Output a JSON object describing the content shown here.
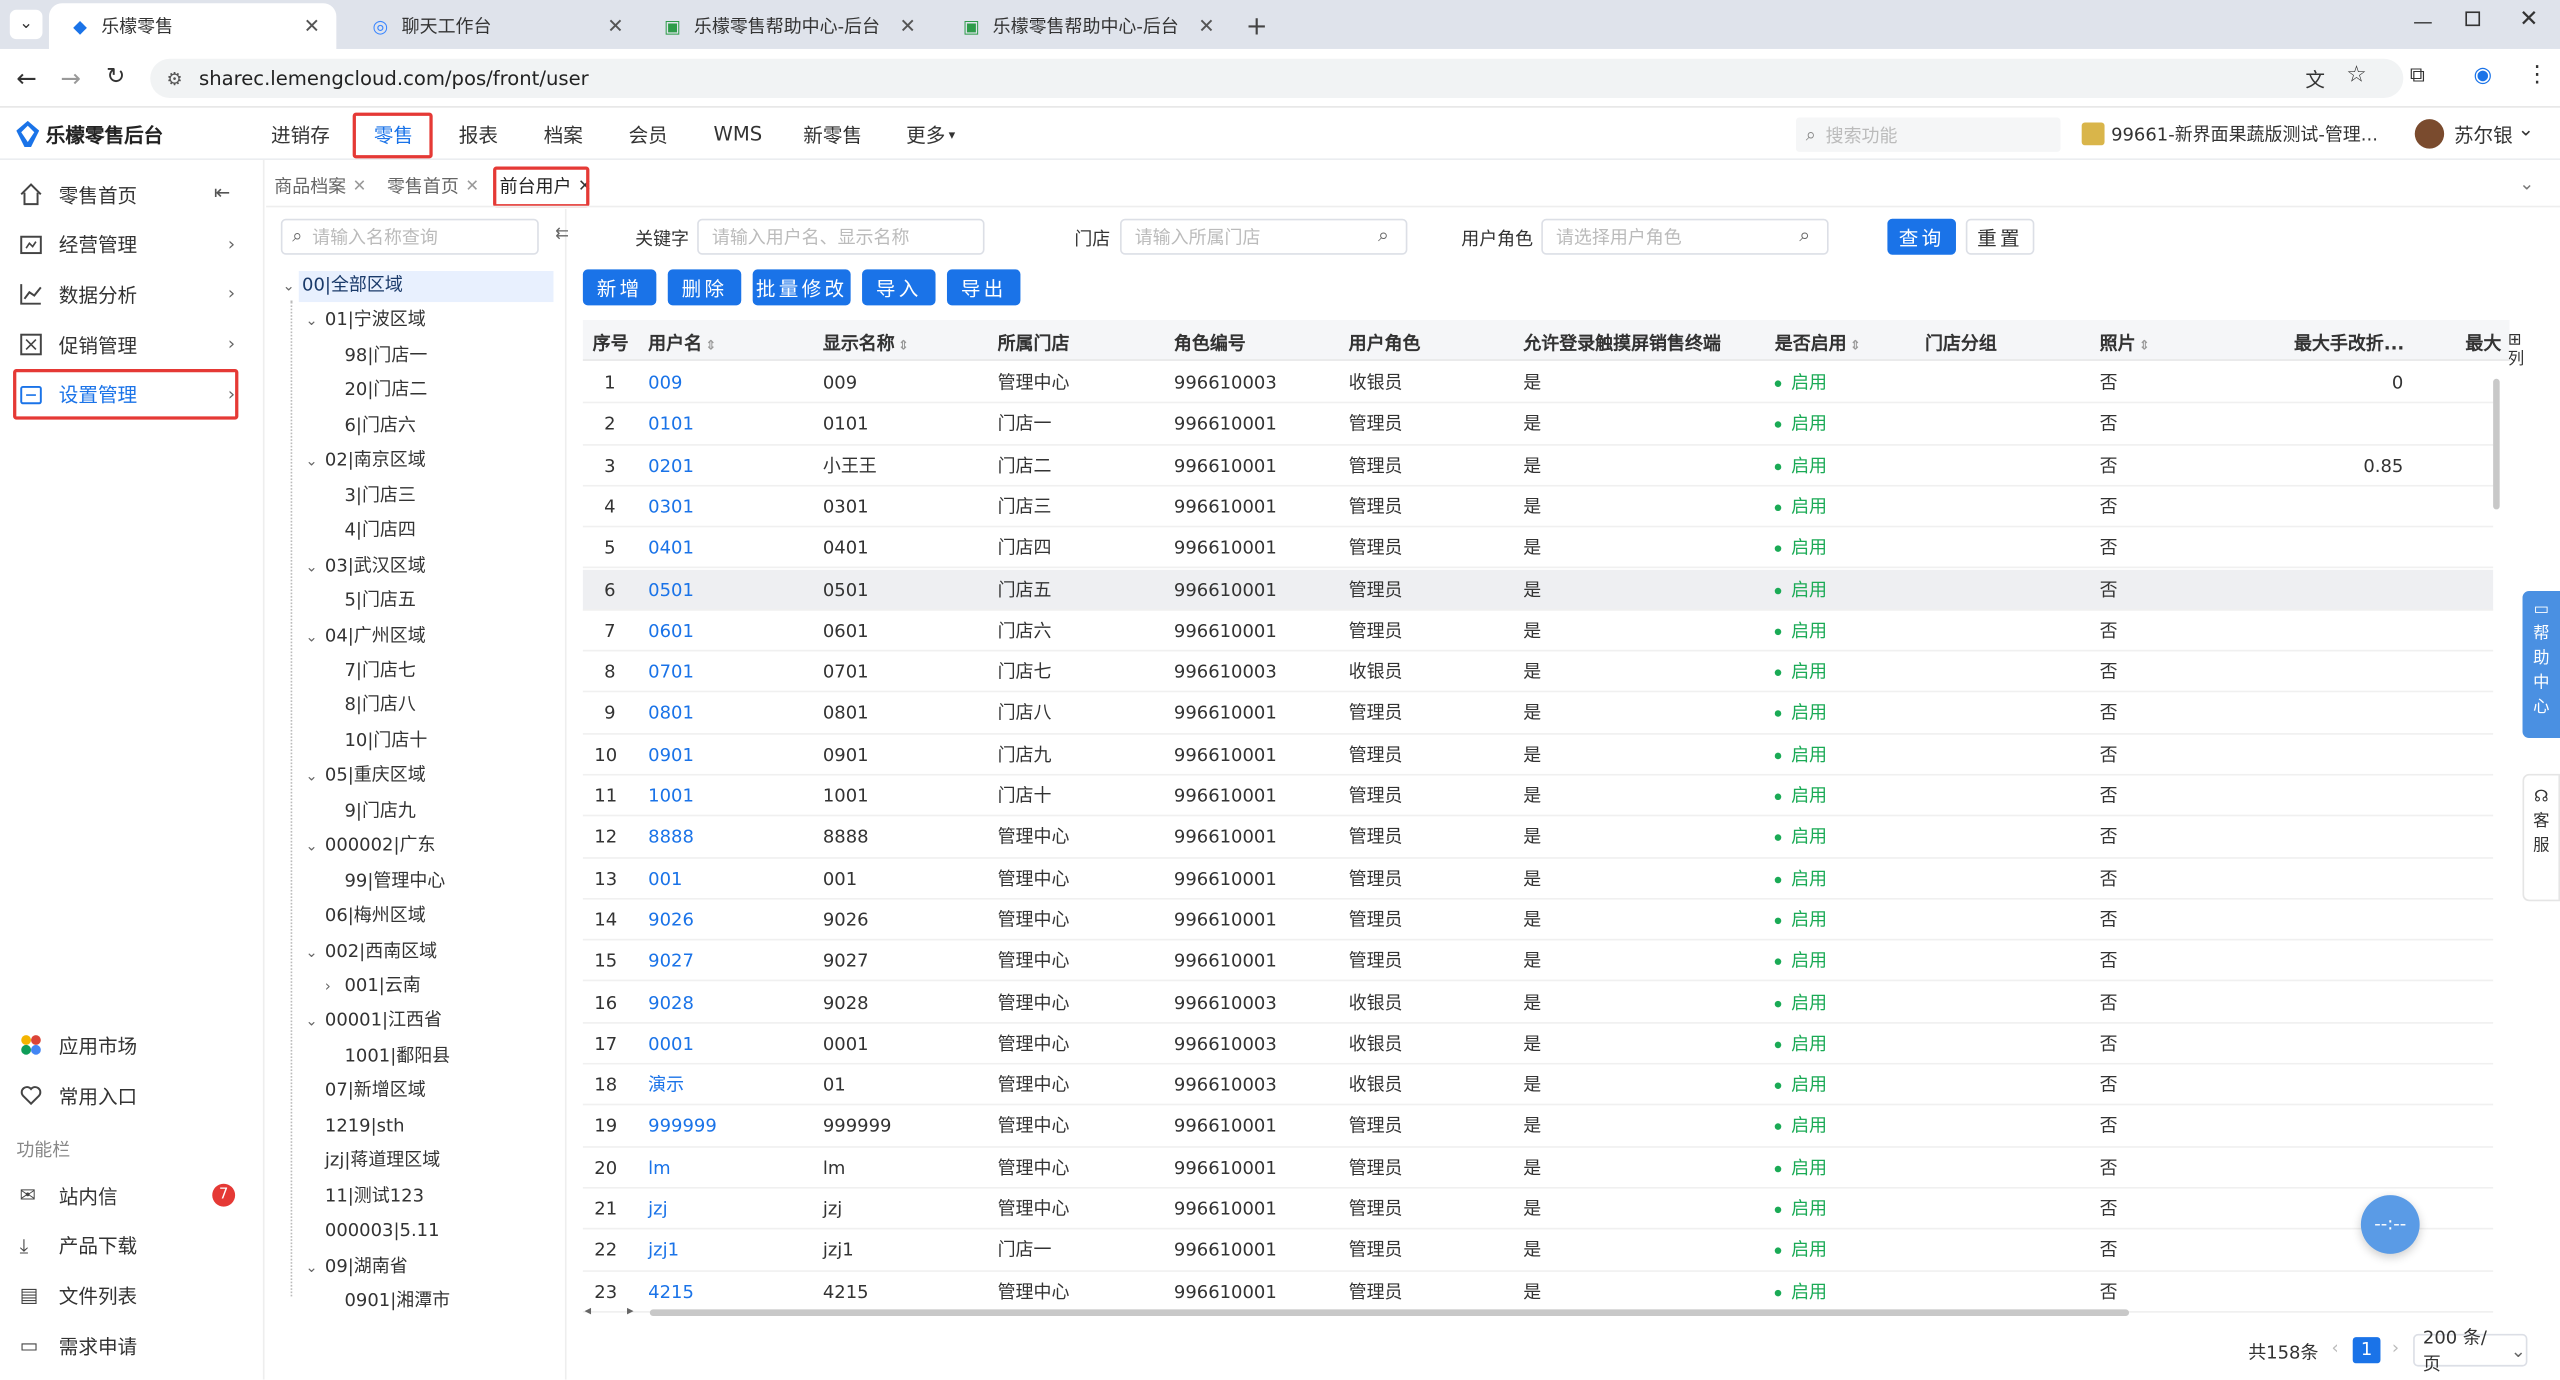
{
  "browser": {
    "tabs": [
      {
        "label": "乐檬零售",
        "active": true
      },
      {
        "label": "聊天工作台"
      },
      {
        "label": "乐檬零售帮助中心-后台"
      },
      {
        "label": "乐檬零售帮助中心-后台"
      }
    ],
    "url": "sharec.lemengcloud.com/pos/front/user"
  },
  "app": {
    "brand": "乐檬零售后台",
    "nav": [
      "进销存",
      "零售",
      "报表",
      "档案",
      "会员",
      "WMS",
      "新零售",
      "更多"
    ],
    "search_placeholder": "搜索功能",
    "store": "99661-新界面果蔬版测试-管理...",
    "user": "苏尔银"
  },
  "sidebar": {
    "items": [
      "零售首页",
      "经营管理",
      "数据分析",
      "促销管理",
      "设置管理"
    ],
    "bottom": [
      "应用市场",
      "常用入口"
    ],
    "section": "功能栏",
    "tools": [
      "站内信",
      "产品下载",
      "文件列表",
      "需求申请"
    ],
    "msg_badge": "7"
  },
  "page_tabs": [
    "商品档案",
    "零售首页",
    "前台用户"
  ],
  "tree": {
    "search_placeholder": "请输入名称查询",
    "nodes": [
      {
        "label": "00|全部区域",
        "level": 0,
        "toggle": "open"
      },
      {
        "label": "01|宁波区域",
        "level": 1,
        "toggle": "open"
      },
      {
        "label": "98|门店一",
        "level": 2
      },
      {
        "label": "20|门店二",
        "level": 2
      },
      {
        "label": "6|门店六",
        "level": 2
      },
      {
        "label": "02|南京区域",
        "level": 1,
        "toggle": "open"
      },
      {
        "label": "3|门店三",
        "level": 2
      },
      {
        "label": "4|门店四",
        "level": 2
      },
      {
        "label": "03|武汉区域",
        "level": 1,
        "toggle": "open"
      },
      {
        "label": "5|门店五",
        "level": 2
      },
      {
        "label": "04|广州区域",
        "level": 1,
        "toggle": "open"
      },
      {
        "label": "7|门店七",
        "level": 2
      },
      {
        "label": "8|门店八",
        "level": 2
      },
      {
        "label": "10|门店十",
        "level": 2
      },
      {
        "label": "05|重庆区域",
        "level": 1,
        "toggle": "open"
      },
      {
        "label": "9|门店九",
        "level": 2
      },
      {
        "label": "000002|广东",
        "level": 1,
        "toggle": "open"
      },
      {
        "label": "99|管理中心",
        "level": 2
      },
      {
        "label": "06|梅州区域",
        "level": 1
      },
      {
        "label": "002|西南区域",
        "level": 1,
        "toggle": "open"
      },
      {
        "label": "001|云南",
        "level": 2,
        "toggle": "closed"
      },
      {
        "label": "00001|江西省",
        "level": 1,
        "toggle": "open"
      },
      {
        "label": "1001|鄱阳县",
        "level": 2
      },
      {
        "label": "07|新增区域",
        "level": 1
      },
      {
        "label": "1219|sth",
        "level": 1
      },
      {
        "label": "jzj|蒋道理区域",
        "level": 1
      },
      {
        "label": "11|测试123",
        "level": 1
      },
      {
        "label": "000003|5.11",
        "level": 1
      },
      {
        "label": "09|湖南省",
        "level": 1,
        "toggle": "open"
      },
      {
        "label": "0901|湘潭市",
        "level": 2
      }
    ]
  },
  "filters": {
    "keyword_label": "关键字",
    "keyword_placeholder": "请输入用户名、显示名称",
    "store_label": "门店",
    "store_placeholder": "请输入所属门店",
    "role_label": "用户角色",
    "role_placeholder": "请选择用户角色",
    "query": "查询",
    "reset": "重置"
  },
  "actions": [
    "新增",
    "删除",
    "批量修改",
    "导入",
    "导出"
  ],
  "table": {
    "columns": [
      "序号",
      "用户名",
      "显示名称",
      "所属门店",
      "角色编号",
      "用户角色",
      "允许登录触摸屏销售终端",
      "是否启用",
      "门店分组",
      "照片",
      "最大手改折...",
      "最大"
    ],
    "col_toggle": "列",
    "rows": [
      [
        "1",
        "009",
        "009",
        "管理中心",
        "996610003",
        "收银员",
        "是",
        "启用",
        "",
        "否",
        "0"
      ],
      [
        "2",
        "0101",
        "0101",
        "门店一",
        "996610001",
        "管理员",
        "是",
        "启用",
        "",
        "否",
        ""
      ],
      [
        "3",
        "0201",
        "小王王",
        "门店二",
        "996610001",
        "管理员",
        "是",
        "启用",
        "",
        "否",
        "0.85"
      ],
      [
        "4",
        "0301",
        "0301",
        "门店三",
        "996610001",
        "管理员",
        "是",
        "启用",
        "",
        "否",
        ""
      ],
      [
        "5",
        "0401",
        "0401",
        "门店四",
        "996610001",
        "管理员",
        "是",
        "启用",
        "",
        "否",
        ""
      ],
      [
        "6",
        "0501",
        "0501",
        "门店五",
        "996610001",
        "管理员",
        "是",
        "启用",
        "",
        "否",
        ""
      ],
      [
        "7",
        "0601",
        "0601",
        "门店六",
        "996610001",
        "管理员",
        "是",
        "启用",
        "",
        "否",
        ""
      ],
      [
        "8",
        "0701",
        "0701",
        "门店七",
        "996610003",
        "收银员",
        "是",
        "启用",
        "",
        "否",
        ""
      ],
      [
        "9",
        "0801",
        "0801",
        "门店八",
        "996610001",
        "管理员",
        "是",
        "启用",
        "",
        "否",
        ""
      ],
      [
        "10",
        "0901",
        "0901",
        "门店九",
        "996610001",
        "管理员",
        "是",
        "启用",
        "",
        "否",
        ""
      ],
      [
        "11",
        "1001",
        "1001",
        "门店十",
        "996610001",
        "管理员",
        "是",
        "启用",
        "",
        "否",
        ""
      ],
      [
        "12",
        "8888",
        "8888",
        "管理中心",
        "996610001",
        "管理员",
        "是",
        "启用",
        "",
        "否",
        ""
      ],
      [
        "13",
        "001",
        "001",
        "管理中心",
        "996610001",
        "管理员",
        "是",
        "启用",
        "",
        "否",
        ""
      ],
      [
        "14",
        "9026",
        "9026",
        "管理中心",
        "996610001",
        "管理员",
        "是",
        "启用",
        "",
        "否",
        ""
      ],
      [
        "15",
        "9027",
        "9027",
        "管理中心",
        "996610001",
        "管理员",
        "是",
        "启用",
        "",
        "否",
        ""
      ],
      [
        "16",
        "9028",
        "9028",
        "管理中心",
        "996610003",
        "收银员",
        "是",
        "启用",
        "",
        "否",
        ""
      ],
      [
        "17",
        "0001",
        "0001",
        "管理中心",
        "996610003",
        "收银员",
        "是",
        "启用",
        "",
        "否",
        ""
      ],
      [
        "18",
        "演示",
        "01",
        "管理中心",
        "996610003",
        "收银员",
        "是",
        "启用",
        "",
        "否",
        ""
      ],
      [
        "19",
        "999999",
        "999999",
        "管理中心",
        "996610001",
        "管理员",
        "是",
        "启用",
        "",
        "否",
        ""
      ],
      [
        "20",
        "lm",
        "lm",
        "管理中心",
        "996610001",
        "管理员",
        "是",
        "启用",
        "",
        "否",
        ""
      ],
      [
        "21",
        "jzj",
        "jzj",
        "管理中心",
        "996610001",
        "管理员",
        "是",
        "启用",
        "",
        "否",
        ""
      ],
      [
        "22",
        "jzj1",
        "jzj1",
        "门店一",
        "996610001",
        "管理员",
        "是",
        "启用",
        "",
        "否",
        ""
      ],
      [
        "23",
        "4215",
        "4215",
        "管理中心",
        "996610001",
        "管理员",
        "是",
        "启用",
        "",
        "否",
        ""
      ]
    ]
  },
  "pagination": {
    "total": "共158条",
    "page": "1",
    "size": "200 条/页"
  },
  "float": {
    "help": "帮助中心",
    "service": "客服"
  },
  "colors": {
    "accent": "#1a73e8",
    "enabled": "#1aaa55",
    "highlight": "#e53935"
  }
}
